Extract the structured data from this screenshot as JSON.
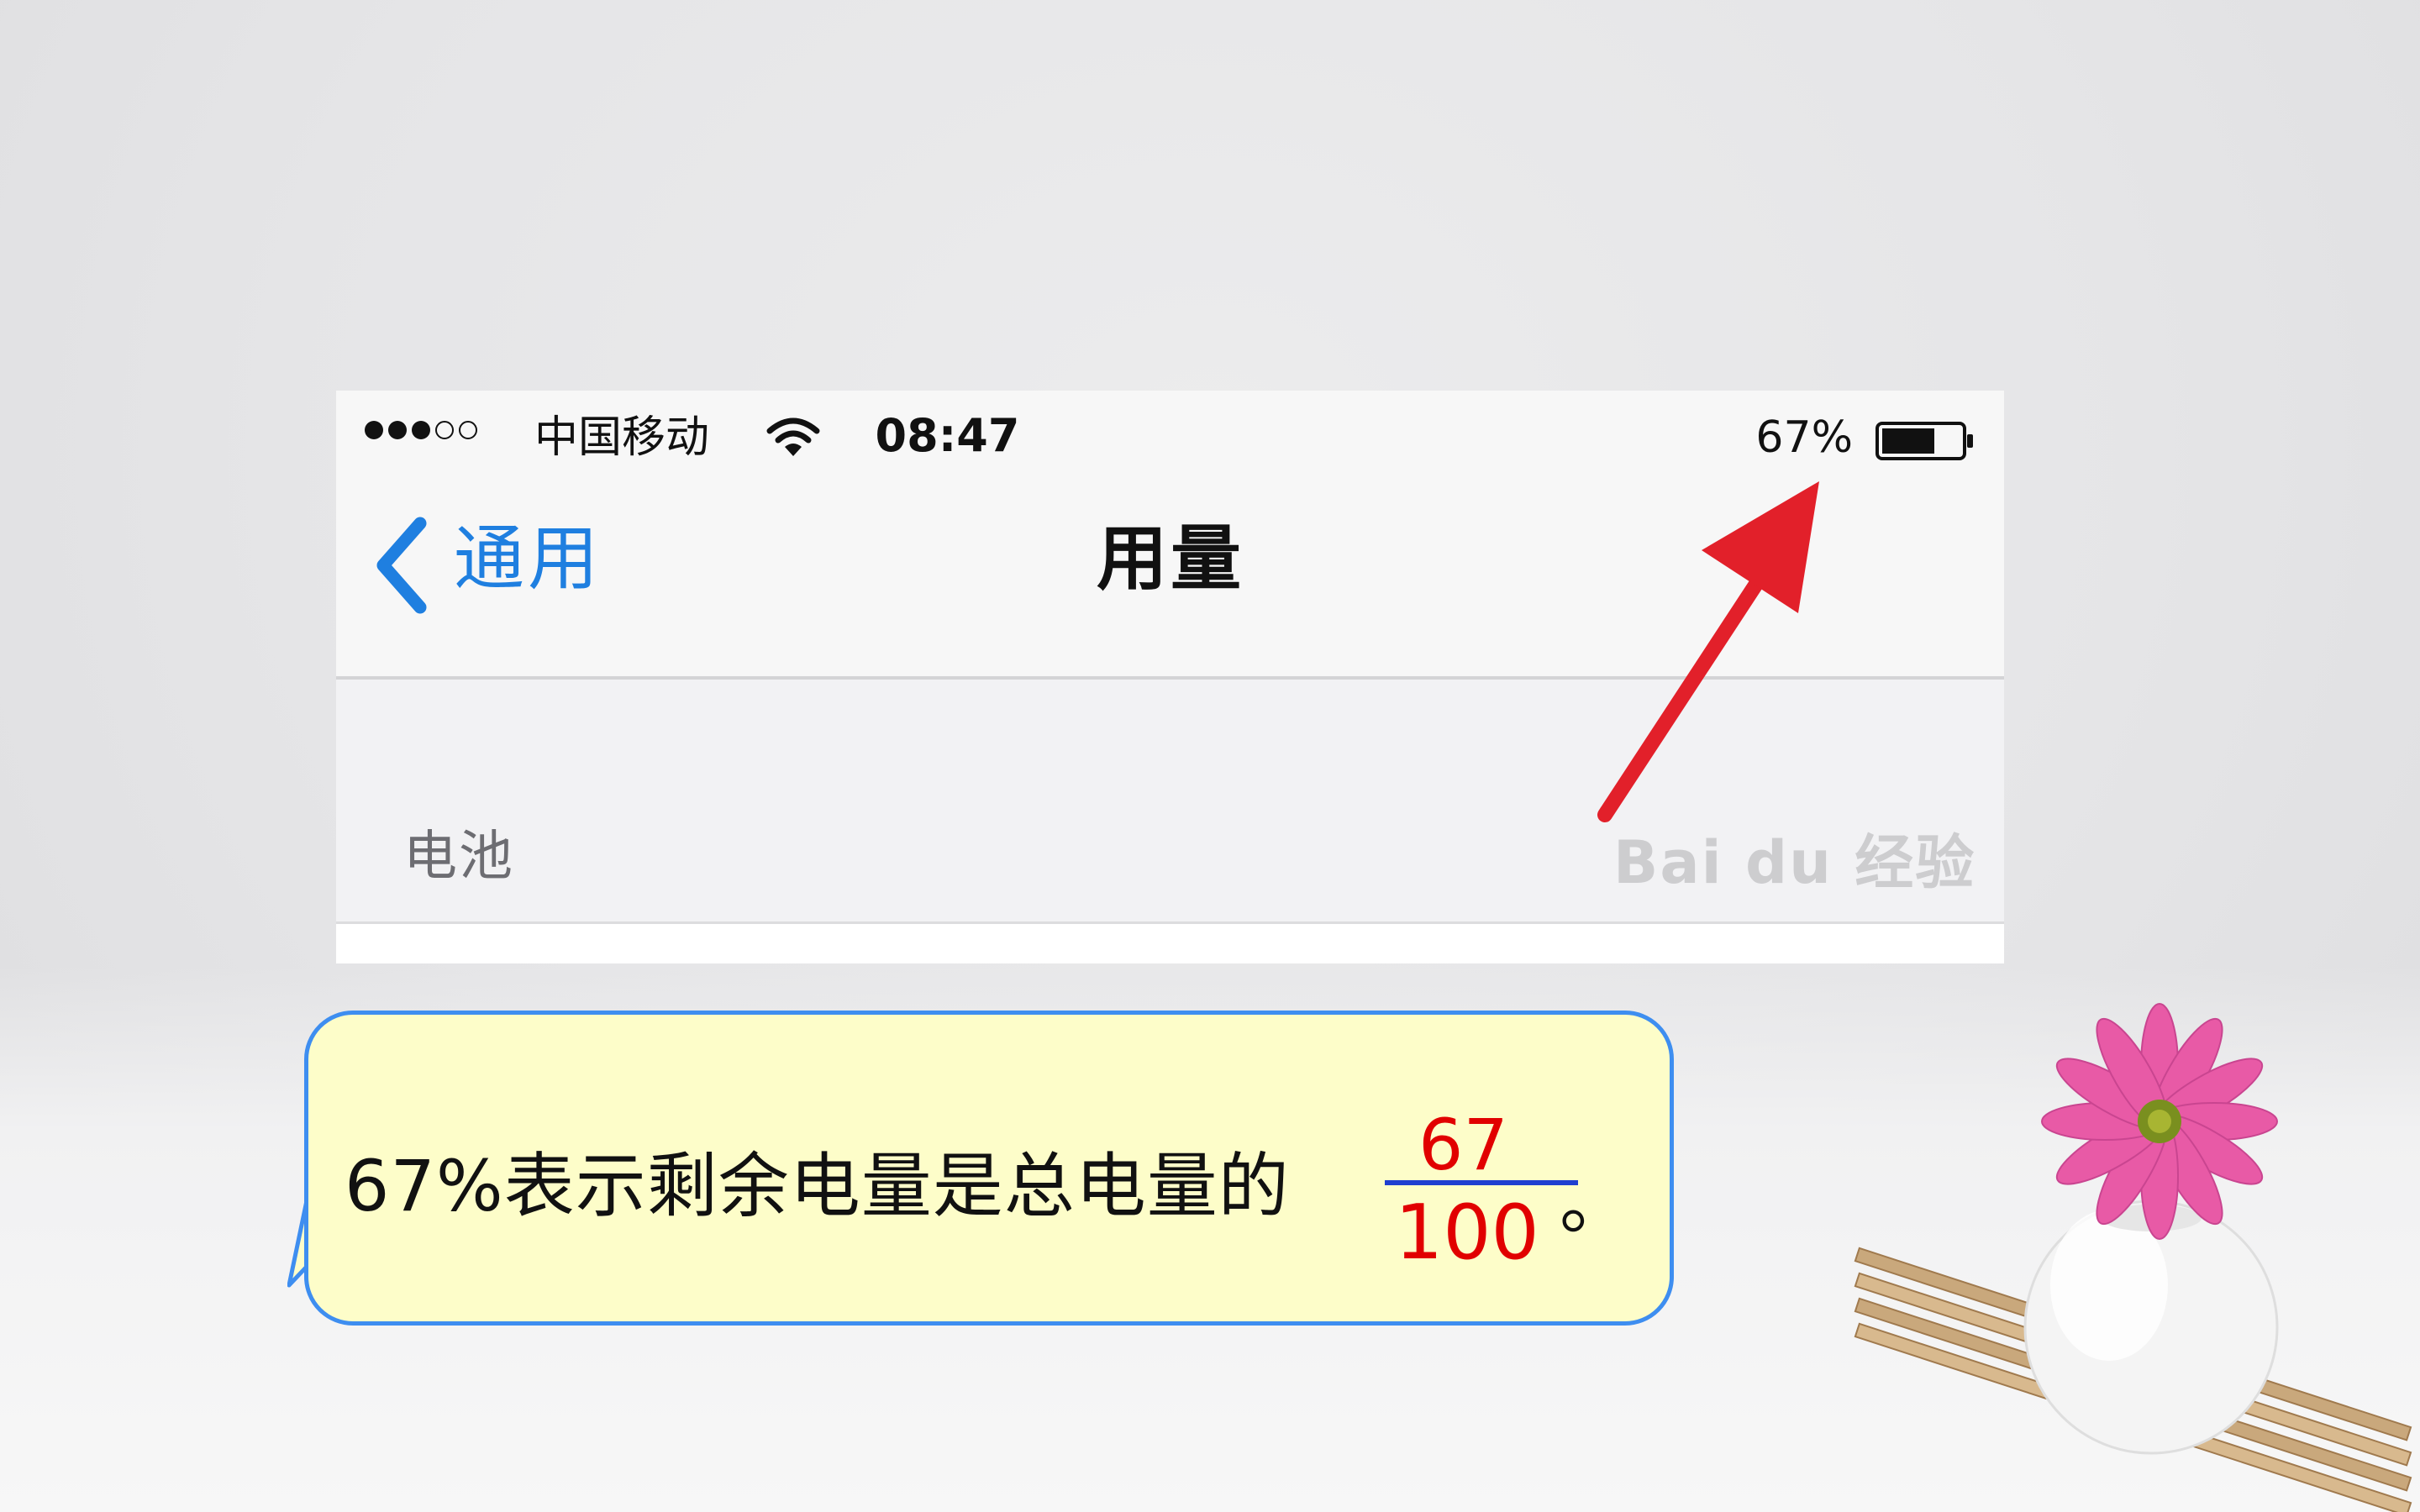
{
  "statusbar": {
    "carrier": "中国移动",
    "time": "08:47",
    "battery_percent": "67%",
    "signal_bars": 3,
    "signal_max": 5,
    "battery_level": 0.67
  },
  "navbar": {
    "back_label": "通用",
    "title": "用量"
  },
  "section": {
    "label": "电池"
  },
  "watermark": {
    "text": "Bai du 经验"
  },
  "callout": {
    "text": "67%表示剩余电量是总电量的",
    "numerator": "67",
    "denominator": "100",
    "period": "。"
  },
  "colors": {
    "ios_blue": "#1f7fe0",
    "arrow_red": "#e2202a",
    "callout_bg": "#fdfdc9",
    "callout_border": "#3e8ef0",
    "fraction_red": "#e10000",
    "fraction_line": "#1f3fd0"
  }
}
